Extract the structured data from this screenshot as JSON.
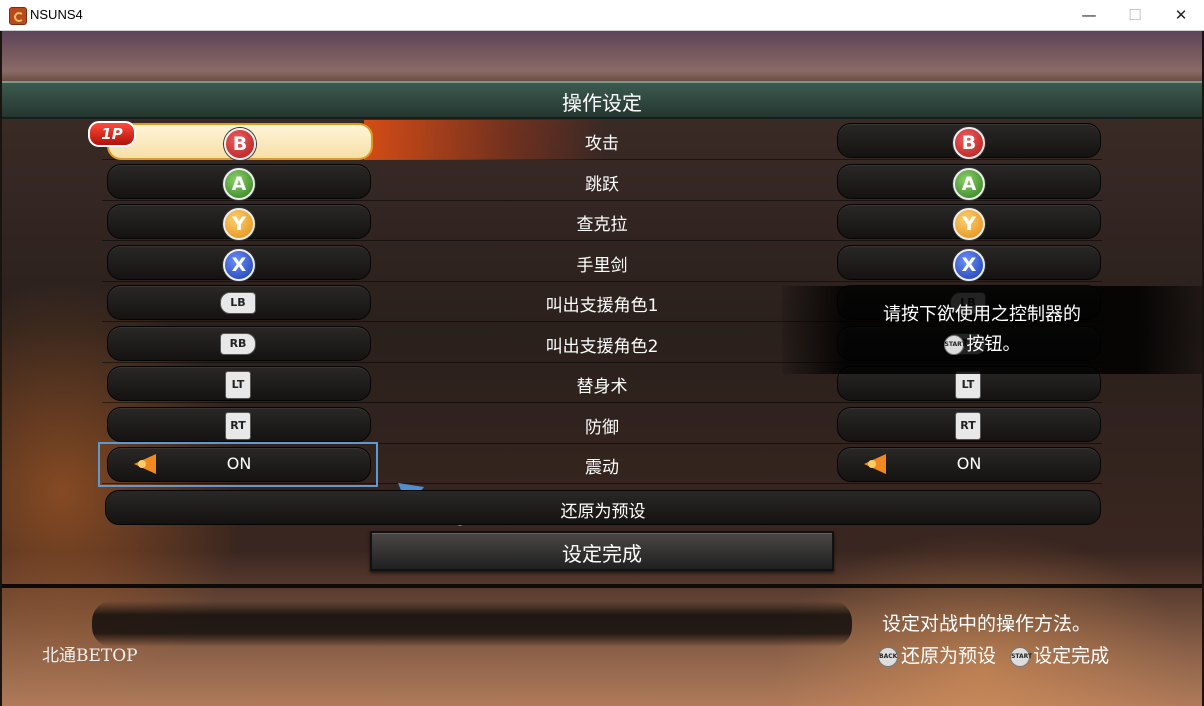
{
  "window": {
    "title": "NSUNS4",
    "minimize": "—",
    "maximize": "☐",
    "close": "✕"
  },
  "panel": {
    "title": "操作设定"
  },
  "player_badge": "1P",
  "rows": [
    {
      "label": "攻击",
      "left": "B",
      "right": "B"
    },
    {
      "label": "跳跃",
      "left": "A",
      "right": "A"
    },
    {
      "label": "查克拉",
      "left": "Y",
      "right": "Y"
    },
    {
      "label": "手里剑",
      "left": "X",
      "right": "X"
    },
    {
      "label": "叫出支援角色1",
      "left": "LB",
      "right": "LB"
    },
    {
      "label": "叫出支援角色2",
      "left": "RB",
      "right": "RB"
    },
    {
      "label": "替身术",
      "left": "LT",
      "right": "LT"
    },
    {
      "label": "防御",
      "left": "RT",
      "right": "RT"
    },
    {
      "label": "震动",
      "left": "ON",
      "right": "ON"
    }
  ],
  "tooltip": {
    "line1": "请按下欲使用之控制器的",
    "line2": "按钮。",
    "icon": "START"
  },
  "reset": "还原为预设",
  "done": "设定完成",
  "footer": {
    "description": "设定对战中的操作方法。",
    "hint_back": "还原为预设",
    "hint_start": "设定完成",
    "back_icon": "BACK",
    "start_icon": "START"
  },
  "watermark": "北通BETOP",
  "colors": {
    "highlight_border": "#5b9bd5",
    "active_slot": "#f6dfa8",
    "header": "#2e463e"
  }
}
